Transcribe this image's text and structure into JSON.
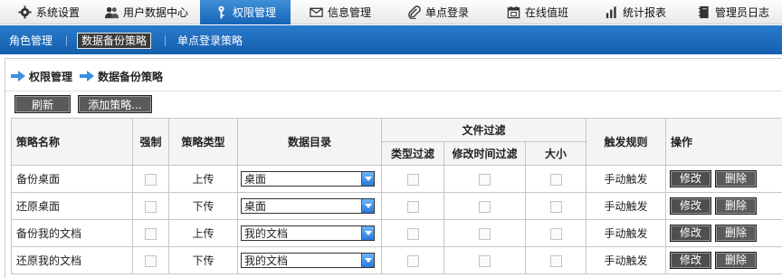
{
  "top_tabs": [
    {
      "label": "系统设置",
      "icon": "gear-icon",
      "active": false
    },
    {
      "label": "用户数据中心",
      "icon": "users-icon",
      "active": false
    },
    {
      "label": "权限管理",
      "icon": "key-icon",
      "active": true
    },
    {
      "label": "信息管理",
      "icon": "mail-icon",
      "active": false
    },
    {
      "label": "单点登录",
      "icon": "paperclip-icon",
      "active": false
    },
    {
      "label": "在线值班",
      "icon": "calendar-icon",
      "active": false
    },
    {
      "label": "统计报表",
      "icon": "bar-chart-icon",
      "active": false
    },
    {
      "label": "管理员日志",
      "icon": "notebook-icon",
      "active": false
    }
  ],
  "sub_nav": [
    {
      "label": "角色管理",
      "active": false
    },
    {
      "label": "数据备份策略",
      "active": true
    },
    {
      "label": "单点登录策略",
      "active": false
    }
  ],
  "breadcrumb": {
    "level1": "权限管理",
    "level2": "数据备份策略"
  },
  "toolbar": {
    "refresh_label": "刷新",
    "add_label": "添加策略..."
  },
  "table": {
    "headers": {
      "name": "策略名称",
      "force": "强制",
      "type": "策略类型",
      "directory": "数据目录",
      "file_filter": "文件过滤",
      "type_filter": "类型过滤",
      "time_filter": "修改时间过滤",
      "size": "大小",
      "trigger": "触发规则",
      "action": "操作"
    },
    "rows": [
      {
        "name": "备份桌面",
        "type": "上传",
        "directory": "桌面",
        "trigger": "手动触发",
        "edit": "修改",
        "delete": "删除"
      },
      {
        "name": "还原桌面",
        "type": "下传",
        "directory": "桌面",
        "trigger": "手动触发",
        "edit": "修改",
        "delete": "删除"
      },
      {
        "name": "备份我的文档",
        "type": "上传",
        "directory": "我的文档",
        "trigger": "手动触发",
        "edit": "修改",
        "delete": "删除"
      },
      {
        "name": "还原我的文档",
        "type": "下传",
        "directory": "我的文档",
        "trigger": "手动触发",
        "edit": "修改",
        "delete": "删除"
      }
    ]
  },
  "colors": {
    "accent": "#1a6bbf",
    "active_subnav": "#3b3b3b",
    "button": "#555555"
  }
}
